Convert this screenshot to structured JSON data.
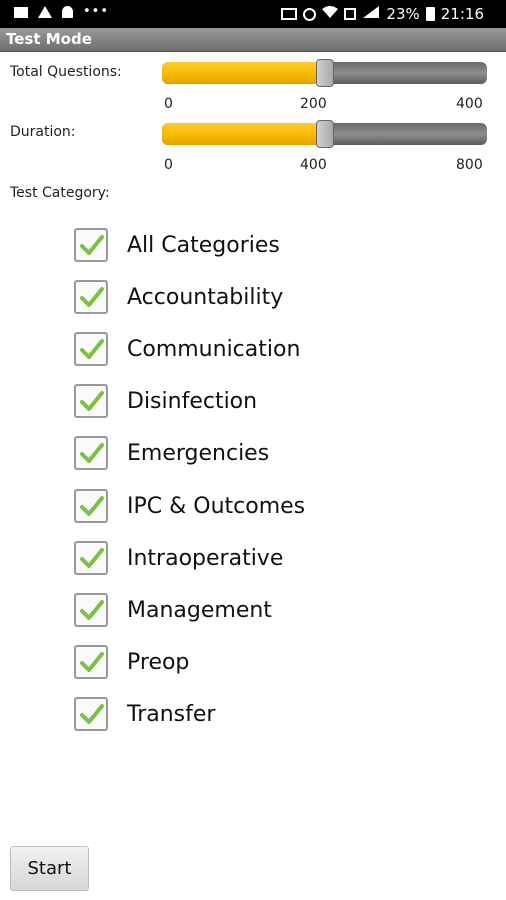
{
  "status_bar": {
    "battery_percent": "23%",
    "time": "21:16",
    "icons": [
      "notification-square-icon",
      "warning-icon",
      "bell-icon",
      "more-dots-icon",
      "cast-icon",
      "alarm-icon",
      "wifi-icon",
      "sim-icon",
      "signal-icon",
      "battery-icon"
    ]
  },
  "app": {
    "title": "Test Mode"
  },
  "total_questions": {
    "label": "Total Questions:",
    "min": "0",
    "mid": "200",
    "max": "400",
    "value_fraction": 0.5
  },
  "duration": {
    "label": "Duration:",
    "min": "0",
    "mid": "400",
    "max": "800",
    "value_fraction": 0.5
  },
  "category": {
    "label": "Test Category:",
    "items": [
      {
        "label": "All Categories",
        "checked": true
      },
      {
        "label": "Accountability",
        "checked": true
      },
      {
        "label": "Communication",
        "checked": true
      },
      {
        "label": "Disinfection",
        "checked": true
      },
      {
        "label": "Emergencies",
        "checked": true
      },
      {
        "label": "IPC & Outcomes",
        "checked": true
      },
      {
        "label": "Intraoperative",
        "checked": true
      },
      {
        "label": "Management",
        "checked": true
      },
      {
        "label": "Preop",
        "checked": true
      },
      {
        "label": "Transfer",
        "checked": true
      }
    ]
  },
  "start_button": {
    "label": "Start"
  },
  "colors": {
    "accent": "#f5b800",
    "check": "#7ac142",
    "title_bar": "#7a7a7a"
  }
}
